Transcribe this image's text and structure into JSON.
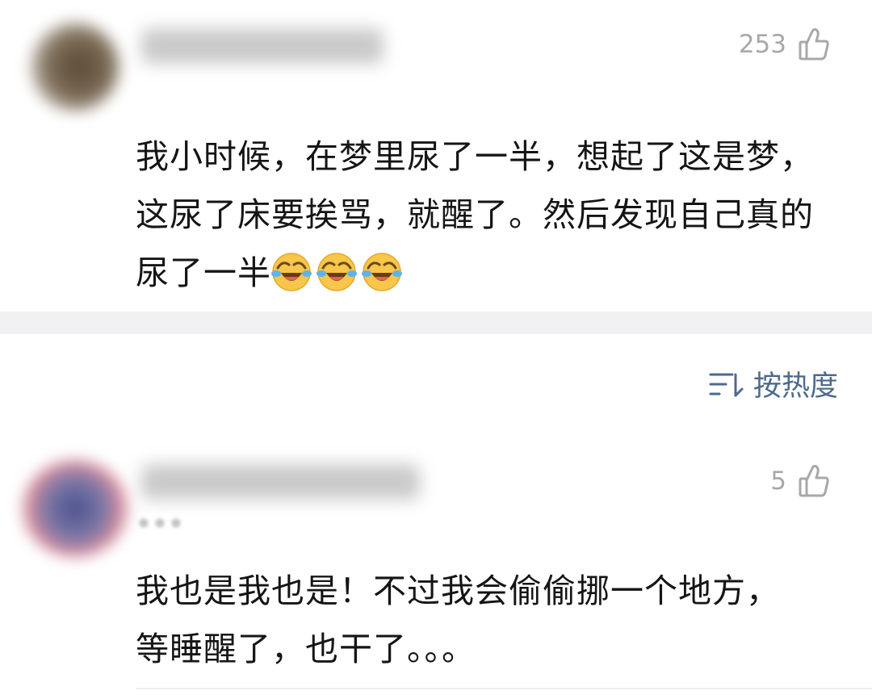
{
  "comments": [
    {
      "like_count": "253",
      "text": "我小时候，在梦里尿了一半，想起了这是梦，这尿了床要挨骂，就醒了。然后发现自己真的尿了一半",
      "emoji": [
        "crying-laughing-emoji",
        "crying-laughing-emoji",
        "crying-laughing-emoji"
      ]
    },
    {
      "like_count": "5",
      "text": "我也是我也是！不过我会偷偷挪一个地方，等睡醒了，也干了。。。"
    }
  ],
  "sort": {
    "label": "按热度",
    "icon": "sort-icon"
  },
  "colors": {
    "accent": "#4d6a8e",
    "like_gray": "#a8a8a8",
    "separator": "#f0f0f2"
  }
}
